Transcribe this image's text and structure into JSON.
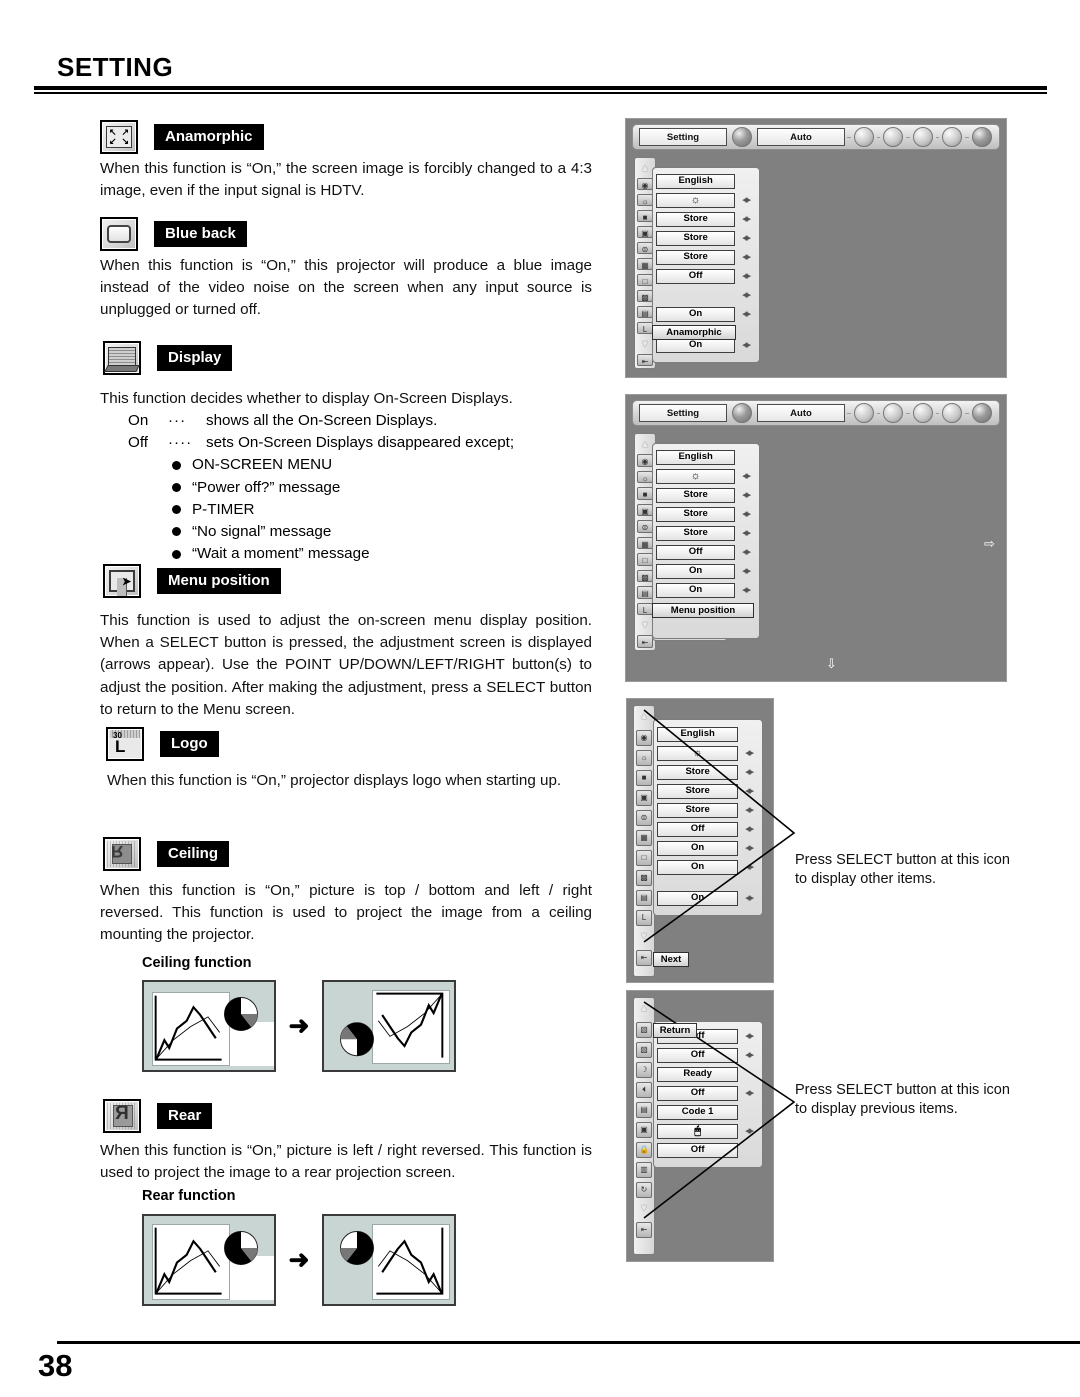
{
  "page": {
    "title": "SETTING",
    "number": "38"
  },
  "sections": [
    {
      "id": "anamorphic",
      "icon": "anamorphic-icon",
      "label": "Anamorphic",
      "body": "When this function is “On,” the screen image is forcibly changed to a 4:3 image, even if the input signal is HDTV."
    },
    {
      "id": "blue-back",
      "icon": "blue-back-icon",
      "label": "Blue back",
      "body": "When this function is “On,” this projector will produce a blue image instead of the video noise on the screen when any input source is unplugged or turned off."
    },
    {
      "id": "display",
      "icon": "display-icon",
      "label": "Display",
      "body": "This function decides whether to display On-Screen Displays.",
      "definitions": [
        {
          "term": "On",
          "dots": "···",
          "text": "shows all the On-Screen Displays."
        },
        {
          "term": "Off",
          "dots": "····",
          "text": "sets On-Screen Displays disappeared except;"
        }
      ],
      "bullets": [
        "ON-SCREEN MENU",
        "“Power off?” message",
        "P-TIMER",
        "“No signal” message",
        "“Wait a moment” message"
      ]
    },
    {
      "id": "menu-position",
      "icon": "menu-position-icon",
      "label": "Menu position",
      "body": "This function is used to adjust the on-screen menu display position. When a SELECT button is pressed, the adjustment screen is displayed (arrows appear). Use the POINT UP/DOWN/LEFT/RIGHT button(s) to adjust the position. After making the adjustment, press a SELECT button to return to the Menu screen."
    },
    {
      "id": "logo",
      "icon": "logo-icon",
      "label": "Logo",
      "badge": "30",
      "glyph": "L",
      "body": "When this function is “On,” projector displays logo when starting up."
    },
    {
      "id": "ceiling",
      "icon": "ceiling-icon",
      "label": "Ceiling",
      "body": "When this function is “On,” picture is top / bottom and left / right reversed.  This function is used to project the image from a ceiling mounting the projector.",
      "figure_caption": "Ceiling function"
    },
    {
      "id": "rear",
      "icon": "rear-icon",
      "label": "Rear",
      "body": "When this function is “On,” picture is left / right reversed.  This function is used to project the image to a rear projection screen.",
      "figure_caption": "Rear function"
    }
  ],
  "osd": {
    "topbar": {
      "tab_setting": "Setting",
      "tab_auto": "Auto",
      "icons": [
        "settings-gear-icon",
        "contrast-icon",
        "color-icon",
        "image-icon",
        "sound-icon",
        "setting-wrench-icon"
      ]
    },
    "screen1": {
      "items": [
        {
          "value": "English",
          "arrows": false
        },
        {
          "value": "",
          "icon": "lamp-icon",
          "arrows": true
        },
        {
          "value": "Store",
          "arrows": true
        },
        {
          "value": "Store",
          "arrows": true
        },
        {
          "value": "Store",
          "arrows": true
        },
        {
          "value": "Off",
          "arrows": true
        },
        {
          "value": "",
          "arrows": true
        },
        {
          "value": "On",
          "arrows": true
        },
        {
          "value": "",
          "arrows": false,
          "spacer": true
        },
        {
          "value": "On",
          "arrows": true
        }
      ],
      "highlight": "Anamorphic"
    },
    "screen2": {
      "items": [
        {
          "value": "English",
          "arrows": false
        },
        {
          "value": "",
          "icon": "lamp-icon",
          "arrows": true
        },
        {
          "value": "Store",
          "arrows": true
        },
        {
          "value": "Store",
          "arrows": true
        },
        {
          "value": "Store",
          "arrows": true
        },
        {
          "value": "Off",
          "arrows": true
        },
        {
          "value": "On",
          "arrows": true
        },
        {
          "value": "On",
          "arrows": true
        },
        {
          "value": "",
          "arrows": false,
          "spacer": true
        },
        {
          "value": "",
          "arrows": true
        }
      ],
      "highlight": "Menu position",
      "right_arrow": "⇨",
      "down_arrow": "⇩"
    },
    "screen3": {
      "items": [
        {
          "value": "English",
          "arrows": false
        },
        {
          "value": "",
          "icon": "lamp-icon",
          "arrows": true
        },
        {
          "value": "Store",
          "arrows": true
        },
        {
          "value": "Store",
          "arrows": true
        },
        {
          "value": "Store",
          "arrows": true
        },
        {
          "value": "Off",
          "arrows": true
        },
        {
          "value": "On",
          "arrows": true
        },
        {
          "value": "On",
          "arrows": true
        },
        {
          "value": "",
          "arrows": false,
          "spacer": true
        },
        {
          "value": "On",
          "arrows": true
        }
      ],
      "highlight": "Next",
      "callout": "Press SELECT button at this icon to display other items."
    },
    "screen4": {
      "items": [
        {
          "value": "Off",
          "arrows": true
        },
        {
          "value": "Off",
          "arrows": true
        },
        {
          "value": "Ready",
          "arrows": false
        },
        {
          "value": "Off",
          "arrows": true
        },
        {
          "value": "Code 1",
          "arrows": false
        },
        {
          "value": "",
          "icon": "mouse-icon",
          "arrows": true
        },
        {
          "value": "Off",
          "arrows": false
        }
      ],
      "highlight": "Return",
      "callout": "Press SELECT button at this icon to display previous items."
    }
  }
}
